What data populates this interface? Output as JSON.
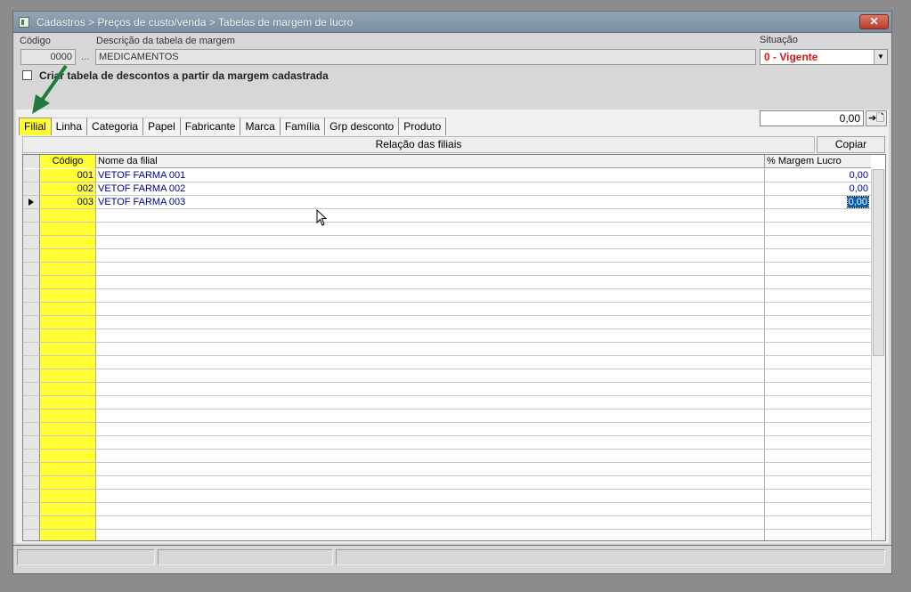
{
  "window": {
    "title": "Cadastros > Preços de custo/venda > Tabelas de margem de lucro",
    "close_label": "✕"
  },
  "header": {
    "codigo_label": "Código",
    "codigo_value": "0000",
    "ellipsis": "...",
    "descricao_label": "Descrição da tabela de margem",
    "descricao_value": "MEDICAMENTOS",
    "situacao_label": "Situação",
    "situacao_value": "0 - Vigente"
  },
  "checkbox": {
    "label": "Criar tabela de descontos a partir da margem cadastrada",
    "checked": false
  },
  "tabs": [
    {
      "label": "Filial",
      "active": true
    },
    {
      "label": "Linha"
    },
    {
      "label": "Categoria"
    },
    {
      "label": "Papel"
    },
    {
      "label": "Fabricante"
    },
    {
      "label": "Marca"
    },
    {
      "label": "Família"
    },
    {
      "label": "Grp desconto"
    },
    {
      "label": "Produto"
    }
  ],
  "toolbar": {
    "value_input": "0,00",
    "apply_icon": "arrow-to-doc-icon",
    "apply_label": "➔🗋"
  },
  "relation": {
    "header": "Relação das filiais",
    "copy_label": "Copiar"
  },
  "grid": {
    "columns": {
      "codigo": "Código",
      "nome": "Nome da filial",
      "margem": "% Margem Lucro"
    },
    "rows": [
      {
        "codigo": "001",
        "nome": "VETOF FARMA 001",
        "margem": "0,00"
      },
      {
        "codigo": "002",
        "nome": "VETOF FARMA 002",
        "margem": "0,00"
      },
      {
        "codigo": "003",
        "nome": "VETOF FARMA 003",
        "margem": "0,00",
        "selected": true
      }
    ]
  },
  "colors": {
    "highlight_yellow": "#ffff33",
    "status_red": "#d11a1a",
    "data_blue": "#00008b",
    "annotation_green": "#1f7a3d"
  }
}
